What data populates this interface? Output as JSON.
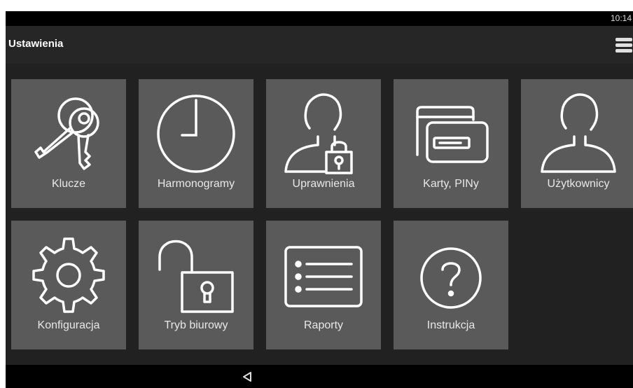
{
  "status_bar": {
    "time": "10:14"
  },
  "app_bar": {
    "title": "Ustawienia",
    "menu_icon": "hamburger-menu-icon"
  },
  "tiles": [
    {
      "label": "Klucze",
      "icon": "keys-icon"
    },
    {
      "label": "Harmonogramy",
      "icon": "clock-icon"
    },
    {
      "label": "Uprawnienia",
      "icon": "user-lock-icon"
    },
    {
      "label": "Karty, PINy",
      "icon": "cards-icon"
    },
    {
      "label": "Użytkownicy",
      "icon": "user-icon"
    },
    {
      "label": "Konfiguracja",
      "icon": "gear-icon"
    },
    {
      "label": "Tryb biurowy",
      "icon": "unlocked-padlock-icon"
    },
    {
      "label": "Raporty",
      "icon": "list-icon"
    },
    {
      "label": "Instrukcja",
      "icon": "help-icon"
    }
  ],
  "nav_bar": {
    "back_icon": "back-triangle-icon"
  },
  "colors": {
    "background": "#212121",
    "tile": "#5a5a5a",
    "text": "#ffffff"
  }
}
